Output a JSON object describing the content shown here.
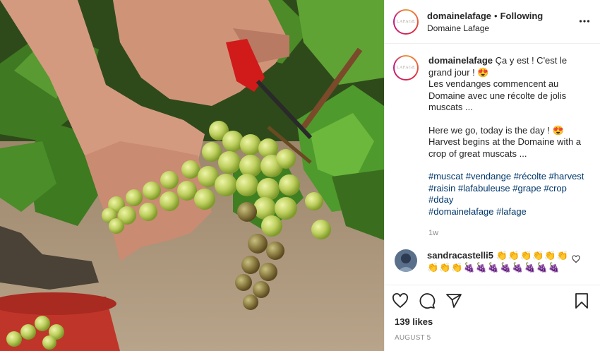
{
  "header": {
    "avatar_text": "LAFAGE",
    "username": "domainelafage",
    "separator": "•",
    "follow_status": "Following",
    "location": "Domaine Lafage"
  },
  "caption": {
    "username": "domainelafage",
    "text_fr": "Ça y est ! C'est le grand jour ! 😍\nLes vendanges commencent au Domaine avec une récolte de jolis muscats ...",
    "text_en": "Here we go, today is the day ! 😍\nHarvest begins at the Domaine with a crop of great muscats ...",
    "hashtags_line1": "#muscat #vendange #récolte #harvest",
    "hashtags_line2": "#raisin #lafabuleuse #grape #crop",
    "hashtags_line3": "#dday",
    "hashtags_line4": "#domainelafage #lafage",
    "time": "1w"
  },
  "comment": {
    "username": "sandracastelli5",
    "emoji_line1": "👏👏👏👏👏👏",
    "emoji_line2": "👏👏👏🍇🍇🍇🍇🍇🍇🍇🍇"
  },
  "likes": "139 likes",
  "date": "AUGUST 5",
  "icons": {
    "more": "more-options-icon",
    "like": "heart-icon",
    "comment": "comment-icon",
    "share": "share-icon",
    "save": "bookmark-icon"
  },
  "colors": {
    "link": "#00376b",
    "muted": "#8e8e8e",
    "border": "#efefef"
  }
}
